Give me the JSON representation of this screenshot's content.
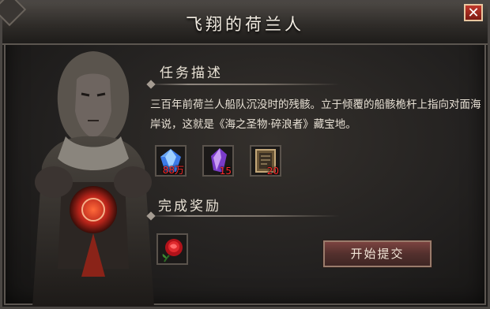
{
  "dialog": {
    "title": "飞翔的荷兰人",
    "close_label": "✕"
  },
  "quest": {
    "description_header": "任务描述",
    "description": "三百年前荷兰人船队沉没时的残骸。立于倾覆的船骸桅杆上指向对面海岸说，这就是《海之圣物·碎浪者》藏宝地。",
    "items": [
      {
        "icon": "blue-crystal-icon",
        "count": "88万"
      },
      {
        "icon": "purple-crystal-icon",
        "count": "15"
      },
      {
        "icon": "scroll-frame-icon",
        "count": "20"
      }
    ]
  },
  "reward": {
    "header": "完成奖励",
    "items": [
      {
        "icon": "red-rose-icon"
      }
    ]
  },
  "actions": {
    "submit_label": "开始提交"
  },
  "colors": {
    "count_text": "#ff2a2a",
    "close_button": "#c1392b",
    "submit_button": "#6b3b38"
  }
}
